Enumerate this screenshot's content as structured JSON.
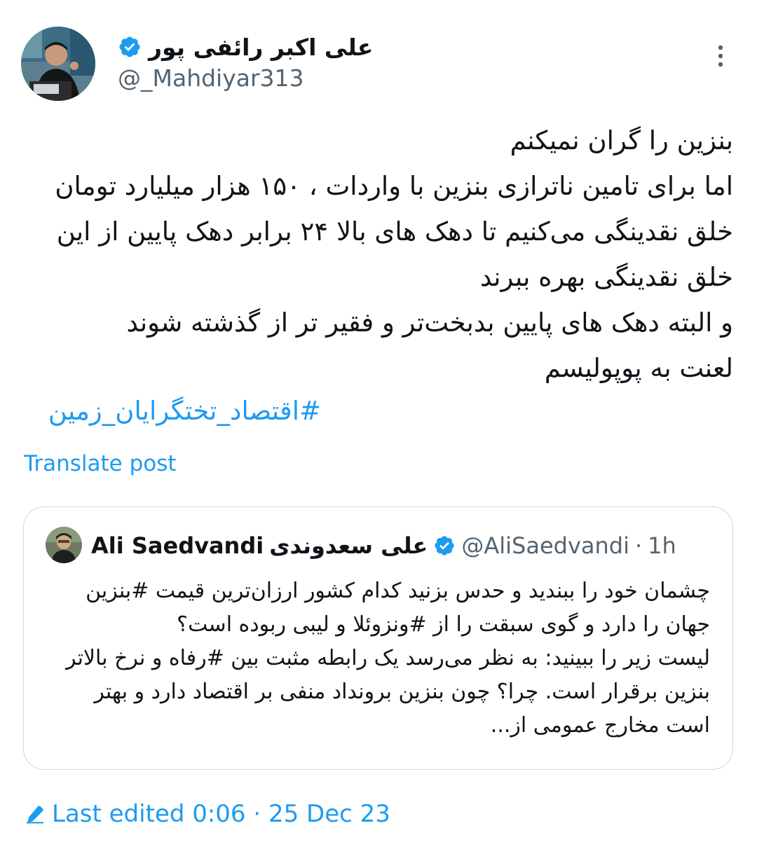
{
  "author": {
    "display_name": "علی اکبر رائفی پور",
    "handle": "@_Mahdiyar313"
  },
  "tweet": {
    "lines": [
      "بنزین را گران نمیکنم",
      "اما برای تامین ناترازی بنزین با واردات ، ۱۵۰ هزار میلیارد تومان",
      "خلق نقدینگی می‌کنیم تا دهک های بالا ۲۴ برابر دهک پایین از این",
      "خلق نقدینگی بهره ببرند",
      "و البته دهک های پایین بدبخت‌تر و فقیر تر از گذشته شوند",
      "لعنت به پوپولیسم"
    ],
    "hashtag": "#اقتصاد_تختگرایان_زمین",
    "translate_label": "Translate post"
  },
  "quote": {
    "name_latin": "Ali Saedvandi",
    "name_persian": "علی سعدوندی",
    "handle": "@AliSaedvandi",
    "separator": "·",
    "time": "1h",
    "lines": [
      "چشمان خود را ببندید و حدس بزنید کدام کشور ارزان‌ترین قیمت #بنزین",
      "جهان را دارد و گوی سبقت را از #ونزوئلا و لیبی ربوده است؟",
      "لیست زیر را ببینید: به نظر می‌رسد یک رابطه مثبت بین #رفاه و نرخ بالاتر",
      "بنزین برقرار است. چرا؟ چون بنزین برونداد منفی بر اقتصاد دارد و بهتر",
      "است مخارج عمومی از..."
    ]
  },
  "footer": {
    "edited_label": "Last edited 0:06 · 25 Dec 23"
  },
  "colors": {
    "accent": "#1d9bf0",
    "text": "#0f1419",
    "muted": "#536471",
    "border": "#cfd9de"
  },
  "icons": {
    "verified": "verified-badge-icon",
    "more": "more-vertical-icon",
    "edit": "pencil-icon"
  }
}
